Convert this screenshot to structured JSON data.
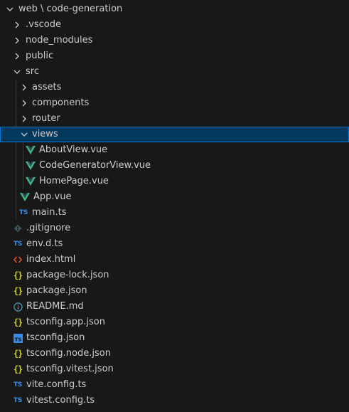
{
  "explorer": {
    "root_label": "web \\ code-generation",
    "colors": {
      "background": "#181818",
      "selection": "#04395e",
      "selection_border": "#0078d4",
      "text": "#cccccc",
      "vue": "#41b883",
      "ts": "#3c8ce7",
      "json": "#cbcb41",
      "html": "#e44d26",
      "info": "#519aba"
    },
    "items": [
      {
        "label": ".vscode",
        "type": "folder",
        "expanded": false,
        "icon": "chevron-right-icon"
      },
      {
        "label": "node_modules",
        "type": "folder",
        "expanded": false,
        "icon": "chevron-right-icon"
      },
      {
        "label": "public",
        "type": "folder",
        "expanded": false,
        "icon": "chevron-right-icon"
      },
      {
        "label": "src",
        "type": "folder",
        "expanded": true,
        "icon": "chevron-down-icon"
      },
      {
        "label": "assets",
        "type": "folder",
        "expanded": false,
        "icon": "chevron-right-icon"
      },
      {
        "label": "components",
        "type": "folder",
        "expanded": false,
        "icon": "chevron-right-icon"
      },
      {
        "label": "router",
        "type": "folder",
        "expanded": false,
        "icon": "chevron-right-icon"
      },
      {
        "label": "views",
        "type": "folder",
        "expanded": true,
        "selected": true,
        "icon": "chevron-down-icon"
      },
      {
        "label": "AboutView.vue",
        "type": "file",
        "icon": "vue-icon"
      },
      {
        "label": "CodeGeneratorView.vue",
        "type": "file",
        "icon": "vue-icon"
      },
      {
        "label": "HomePage.vue",
        "type": "file",
        "icon": "vue-icon"
      },
      {
        "label": "App.vue",
        "type": "file",
        "icon": "vue-icon"
      },
      {
        "label": "main.ts",
        "type": "file",
        "icon": "typescript-icon",
        "icon_text": "TS"
      },
      {
        "label": ".gitignore",
        "type": "file",
        "icon": "git-icon"
      },
      {
        "label": "env.d.ts",
        "type": "file",
        "icon": "typescript-icon",
        "icon_text": "TS"
      },
      {
        "label": "index.html",
        "type": "file",
        "icon": "html-icon"
      },
      {
        "label": "package-lock.json",
        "type": "file",
        "icon": "json-icon",
        "icon_text": "{}"
      },
      {
        "label": "package.json",
        "type": "file",
        "icon": "json-icon",
        "icon_text": "{}"
      },
      {
        "label": "README.md",
        "type": "file",
        "icon": "info-icon"
      },
      {
        "label": "tsconfig.app.json",
        "type": "file",
        "icon": "json-icon",
        "icon_text": "{}"
      },
      {
        "label": "tsconfig.json",
        "type": "file",
        "icon": "tsconfig-icon",
        "icon_text": "TS"
      },
      {
        "label": "tsconfig.node.json",
        "type": "file",
        "icon": "json-icon",
        "icon_text": "{}"
      },
      {
        "label": "tsconfig.vitest.json",
        "type": "file",
        "icon": "json-icon",
        "icon_text": "{}"
      },
      {
        "label": "vite.config.ts",
        "type": "file",
        "icon": "typescript-icon",
        "icon_text": "TS"
      },
      {
        "label": "vitest.config.ts",
        "type": "file",
        "icon": "typescript-icon",
        "icon_text": "TS"
      }
    ]
  }
}
